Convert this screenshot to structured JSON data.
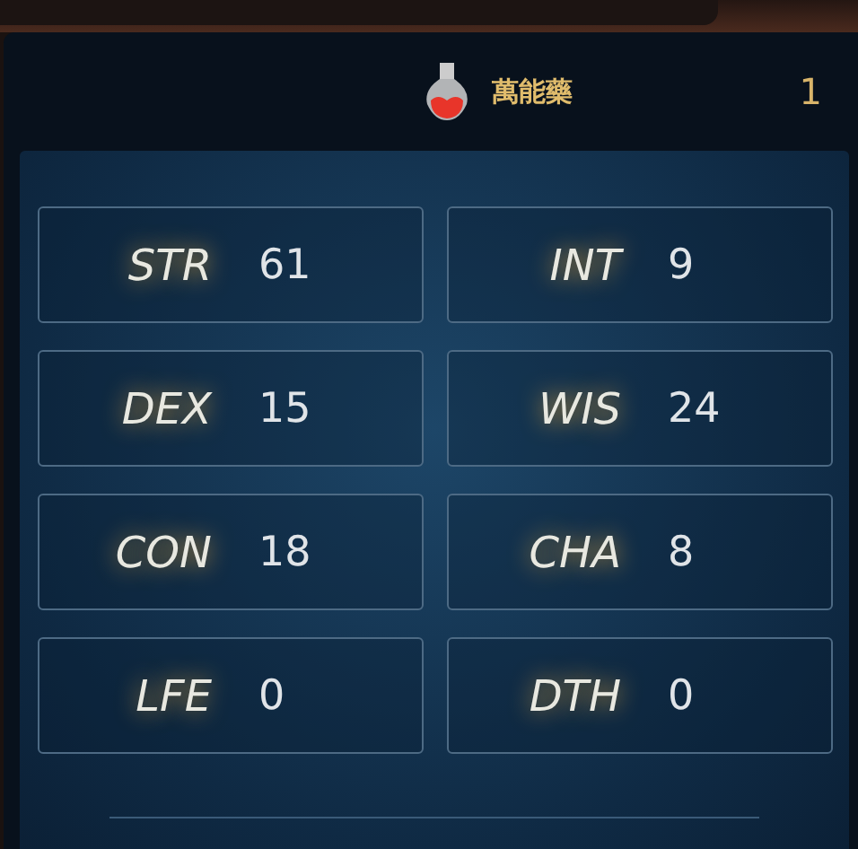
{
  "item": {
    "name": "萬能藥",
    "count": "1"
  },
  "stats": [
    {
      "label": "STR",
      "value": "61"
    },
    {
      "label": "INT",
      "value": "9"
    },
    {
      "label": "DEX",
      "value": "15"
    },
    {
      "label": "WIS",
      "value": "24"
    },
    {
      "label": "CON",
      "value": "18"
    },
    {
      "label": "CHA",
      "value": "8"
    },
    {
      "label": "LFE",
      "value": "0"
    },
    {
      "label": "DTH",
      "value": "0"
    }
  ]
}
